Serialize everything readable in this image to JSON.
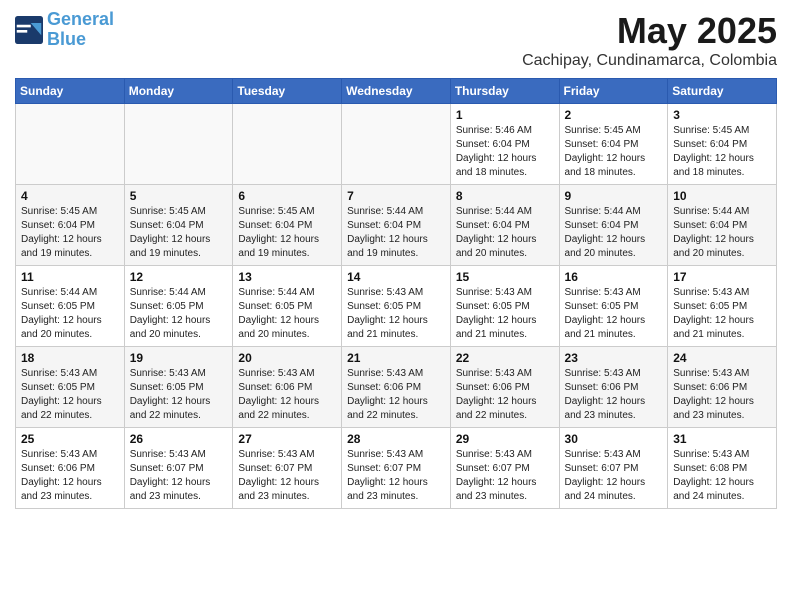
{
  "header": {
    "logo_line1": "General",
    "logo_line2": "Blue",
    "title": "May 2025",
    "subtitle": "Cachipay, Cundinamarca, Colombia"
  },
  "weekdays": [
    "Sunday",
    "Monday",
    "Tuesday",
    "Wednesday",
    "Thursday",
    "Friday",
    "Saturday"
  ],
  "weeks": [
    [
      {
        "day": "",
        "info": ""
      },
      {
        "day": "",
        "info": ""
      },
      {
        "day": "",
        "info": ""
      },
      {
        "day": "",
        "info": ""
      },
      {
        "day": "1",
        "info": "Sunrise: 5:46 AM\nSunset: 6:04 PM\nDaylight: 12 hours\nand 18 minutes."
      },
      {
        "day": "2",
        "info": "Sunrise: 5:45 AM\nSunset: 6:04 PM\nDaylight: 12 hours\nand 18 minutes."
      },
      {
        "day": "3",
        "info": "Sunrise: 5:45 AM\nSunset: 6:04 PM\nDaylight: 12 hours\nand 18 minutes."
      }
    ],
    [
      {
        "day": "4",
        "info": "Sunrise: 5:45 AM\nSunset: 6:04 PM\nDaylight: 12 hours\nand 19 minutes."
      },
      {
        "day": "5",
        "info": "Sunrise: 5:45 AM\nSunset: 6:04 PM\nDaylight: 12 hours\nand 19 minutes."
      },
      {
        "day": "6",
        "info": "Sunrise: 5:45 AM\nSunset: 6:04 PM\nDaylight: 12 hours\nand 19 minutes."
      },
      {
        "day": "7",
        "info": "Sunrise: 5:44 AM\nSunset: 6:04 PM\nDaylight: 12 hours\nand 19 minutes."
      },
      {
        "day": "8",
        "info": "Sunrise: 5:44 AM\nSunset: 6:04 PM\nDaylight: 12 hours\nand 20 minutes."
      },
      {
        "day": "9",
        "info": "Sunrise: 5:44 AM\nSunset: 6:04 PM\nDaylight: 12 hours\nand 20 minutes."
      },
      {
        "day": "10",
        "info": "Sunrise: 5:44 AM\nSunset: 6:04 PM\nDaylight: 12 hours\nand 20 minutes."
      }
    ],
    [
      {
        "day": "11",
        "info": "Sunrise: 5:44 AM\nSunset: 6:05 PM\nDaylight: 12 hours\nand 20 minutes."
      },
      {
        "day": "12",
        "info": "Sunrise: 5:44 AM\nSunset: 6:05 PM\nDaylight: 12 hours\nand 20 minutes."
      },
      {
        "day": "13",
        "info": "Sunrise: 5:44 AM\nSunset: 6:05 PM\nDaylight: 12 hours\nand 20 minutes."
      },
      {
        "day": "14",
        "info": "Sunrise: 5:43 AM\nSunset: 6:05 PM\nDaylight: 12 hours\nand 21 minutes."
      },
      {
        "day": "15",
        "info": "Sunrise: 5:43 AM\nSunset: 6:05 PM\nDaylight: 12 hours\nand 21 minutes."
      },
      {
        "day": "16",
        "info": "Sunrise: 5:43 AM\nSunset: 6:05 PM\nDaylight: 12 hours\nand 21 minutes."
      },
      {
        "day": "17",
        "info": "Sunrise: 5:43 AM\nSunset: 6:05 PM\nDaylight: 12 hours\nand 21 minutes."
      }
    ],
    [
      {
        "day": "18",
        "info": "Sunrise: 5:43 AM\nSunset: 6:05 PM\nDaylight: 12 hours\nand 22 minutes."
      },
      {
        "day": "19",
        "info": "Sunrise: 5:43 AM\nSunset: 6:05 PM\nDaylight: 12 hours\nand 22 minutes."
      },
      {
        "day": "20",
        "info": "Sunrise: 5:43 AM\nSunset: 6:06 PM\nDaylight: 12 hours\nand 22 minutes."
      },
      {
        "day": "21",
        "info": "Sunrise: 5:43 AM\nSunset: 6:06 PM\nDaylight: 12 hours\nand 22 minutes."
      },
      {
        "day": "22",
        "info": "Sunrise: 5:43 AM\nSunset: 6:06 PM\nDaylight: 12 hours\nand 22 minutes."
      },
      {
        "day": "23",
        "info": "Sunrise: 5:43 AM\nSunset: 6:06 PM\nDaylight: 12 hours\nand 23 minutes."
      },
      {
        "day": "24",
        "info": "Sunrise: 5:43 AM\nSunset: 6:06 PM\nDaylight: 12 hours\nand 23 minutes."
      }
    ],
    [
      {
        "day": "25",
        "info": "Sunrise: 5:43 AM\nSunset: 6:06 PM\nDaylight: 12 hours\nand 23 minutes."
      },
      {
        "day": "26",
        "info": "Sunrise: 5:43 AM\nSunset: 6:07 PM\nDaylight: 12 hours\nand 23 minutes."
      },
      {
        "day": "27",
        "info": "Sunrise: 5:43 AM\nSunset: 6:07 PM\nDaylight: 12 hours\nand 23 minutes."
      },
      {
        "day": "28",
        "info": "Sunrise: 5:43 AM\nSunset: 6:07 PM\nDaylight: 12 hours\nand 23 minutes."
      },
      {
        "day": "29",
        "info": "Sunrise: 5:43 AM\nSunset: 6:07 PM\nDaylight: 12 hours\nand 23 minutes."
      },
      {
        "day": "30",
        "info": "Sunrise: 5:43 AM\nSunset: 6:07 PM\nDaylight: 12 hours\nand 24 minutes."
      },
      {
        "day": "31",
        "info": "Sunrise: 5:43 AM\nSunset: 6:08 PM\nDaylight: 12 hours\nand 24 minutes."
      }
    ]
  ]
}
